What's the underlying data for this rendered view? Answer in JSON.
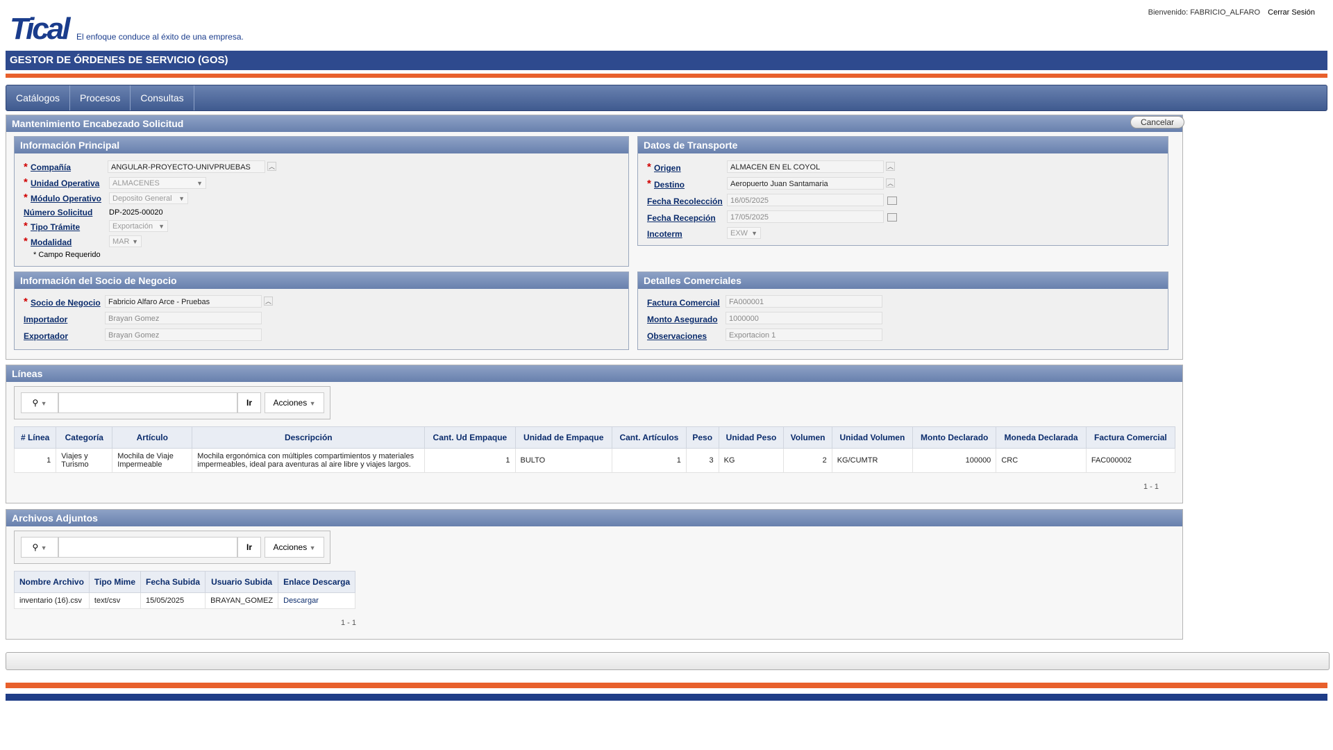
{
  "header": {
    "logo_text": "Tical",
    "tagline": "El enfoque conduce al éxito de una empresa.",
    "welcome": "Bienvenido: FABRICIO_ALFARO",
    "logout": "Cerrar Sesión",
    "app_title": "GESTOR DE ÓRDENES DE SERVICIO (GOS)"
  },
  "menu": [
    "Catálogos",
    "Procesos",
    "Consultas"
  ],
  "main_region": {
    "title": "Mantenimiento Encabezado Solicitud",
    "cancel_label": "Cancelar"
  },
  "info_principal": {
    "title": "Información Principal",
    "compania_label": "Compañía",
    "compania_value": "ANGULAR-PROYECTO-UNIVPRUEBAS",
    "unidad_label": "Unidad Operativa",
    "unidad_value": "ALMACENES",
    "modulo_label": "Módulo Operativo",
    "modulo_value": "Deposito General",
    "numero_label": "Número Solicitud",
    "numero_value": "DP-2025-00020",
    "tramite_label": "Tipo Trámite",
    "tramite_value": "Exportación",
    "modalidad_label": "Modalidad",
    "modalidad_value": "MAR",
    "required_note": "* Campo Requerido"
  },
  "transporte": {
    "title": "Datos de Transporte",
    "origen_label": "Origen",
    "origen_value": "ALMACEN EN EL COYOL",
    "destino_label": "Destino",
    "destino_value": "Aeropuerto Juan Santamaria",
    "recoleccion_label": "Fecha Recolección",
    "recoleccion_value": "16/05/2025",
    "recepcion_label": "Fecha Recepción",
    "recepcion_value": "17/05/2025",
    "incoterm_label": "Incoterm",
    "incoterm_value": "EXW"
  },
  "socio": {
    "title": "Información del Socio de Negocio",
    "socio_label": "Socio de Negocio",
    "socio_value": "Fabricio Alfaro Arce - Pruebas",
    "importador_label": "Importador",
    "importador_value": "Brayan Gomez",
    "exportador_label": "Exportador",
    "exportador_value": "Brayan Gomez"
  },
  "comerciales": {
    "title": "Detalles Comerciales",
    "factura_label": "Factura Comercial",
    "factura_value": "FA000001",
    "monto_label": "Monto Asegurado",
    "monto_value": "1000000",
    "obs_label": "Observaciones",
    "obs_value": "Exportacion 1"
  },
  "lineas": {
    "title": "Líneas",
    "go_label": "Ir",
    "actions_label": "Acciones",
    "columns": [
      "# Línea",
      "Categoría",
      "Artículo",
      "Descripción",
      "Cant. Ud Empaque",
      "Unidad de Empaque",
      "Cant. Artículos",
      "Peso",
      "Unidad Peso",
      "Volumen",
      "Unidad Volumen",
      "Monto Declarado",
      "Moneda Declarada",
      "Factura Comercial"
    ],
    "rows": [
      [
        "1",
        "Viajes y Turismo",
        "Mochila de Viaje Impermeable",
        "Mochila ergonómica con múltiples compartimientos y materiales impermeables, ideal para aventuras al aire libre y viajes largos.",
        "1",
        "BULTO",
        "1",
        "3",
        "KG",
        "2",
        "KG/CUMTR",
        "100000",
        "CRC",
        "FAC000002"
      ]
    ],
    "pagination": "1 - 1"
  },
  "adjuntos": {
    "title": "Archivos Adjuntos",
    "go_label": "Ir",
    "actions_label": "Acciones",
    "columns": [
      "Nombre Archivo",
      "Tipo Mime",
      "Fecha Subida",
      "Usuario Subida",
      "Enlace Descarga"
    ],
    "rows": [
      [
        "inventario (16).csv",
        "text/csv",
        "15/05/2025",
        "BRAYAN_GOMEZ",
        "Descargar"
      ]
    ],
    "pagination": "1 - 1"
  },
  "colors": {
    "brand_blue": "#2e4a8e",
    "brand_orange": "#e8602c",
    "label_blue": "#0b2c6c"
  }
}
